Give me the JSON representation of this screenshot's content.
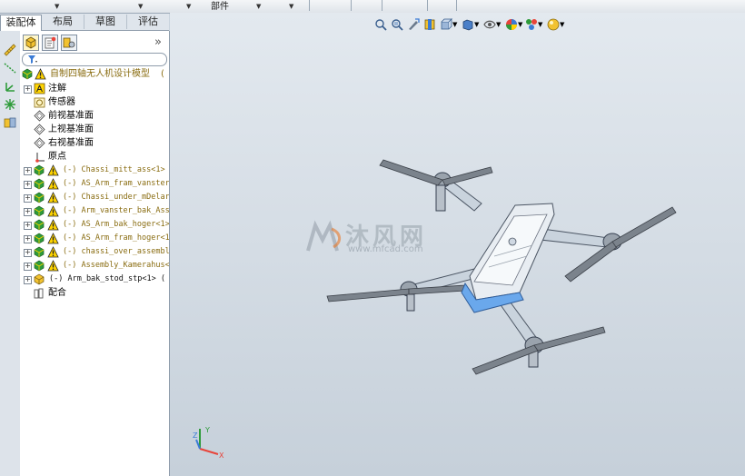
{
  "toolbar": {
    "partial_label": "部件"
  },
  "tabs": [
    {
      "label": "装配体",
      "active": true
    },
    {
      "label": "布局",
      "active": false
    },
    {
      "label": "草图",
      "active": false
    },
    {
      "label": "评估",
      "active": false
    }
  ],
  "panel": {
    "more": "»"
  },
  "tree": {
    "root": "自制四轴无人机设计模型",
    "items": [
      {
        "label": "注解",
        "icon": "annotation-icon",
        "expandable": true
      },
      {
        "label": "传感器",
        "icon": "sensor-icon",
        "expandable": false
      },
      {
        "label": "前视基准面",
        "icon": "plane-icon",
        "expandable": false
      },
      {
        "label": "上视基准面",
        "icon": "plane-icon",
        "expandable": false
      },
      {
        "label": "右视基准面",
        "icon": "plane-icon",
        "expandable": false
      },
      {
        "label": "原点",
        "icon": "origin-icon",
        "expandable": false
      },
      {
        "label": "(-) Chassi_mitt_ass<1>",
        "icon": "assembly-warning-icon",
        "expandable": true
      },
      {
        "label": "(-) AS_Arm_fram_vanster",
        "icon": "assembly-warning-icon",
        "expandable": true
      },
      {
        "label": "(-) Chassi_under_mDelar",
        "icon": "assembly-warning-icon",
        "expandable": true
      },
      {
        "label": "(-) Arm_vanster_bak_Ass",
        "icon": "assembly-warning-icon",
        "expandable": true
      },
      {
        "label": "(-) AS_Arm_bak_hoger<1>",
        "icon": "assembly-warning-icon",
        "expandable": true
      },
      {
        "label": "(-) AS_Arm_fram_hoger<1",
        "icon": "assembly-warning-icon",
        "expandable": true
      },
      {
        "label": "(-) chassi_over_assembl",
        "icon": "assembly-warning-icon",
        "expandable": true
      },
      {
        "label": "(-) Assembly_Kamerahus<",
        "icon": "assembly-warning-icon",
        "expandable": true
      },
      {
        "label": "(-) Arm_bak_stod_stp<1> (",
        "icon": "part-icon",
        "expandable": true
      },
      {
        "label": "配合",
        "icon": "mates-icon",
        "expandable": false
      }
    ]
  },
  "watermark": {
    "text": "沐风网",
    "url": "www.mfcad.com"
  },
  "triad": {
    "x": "X",
    "y": "Y",
    "z": "Z"
  },
  "colors": {
    "accent_blue": "#3a7bd5",
    "warning_yellow": "#ffd400",
    "assembly_green": "#2e9b3a",
    "drone_gray": "#6b7280",
    "drone_body": "#e8edf2"
  }
}
